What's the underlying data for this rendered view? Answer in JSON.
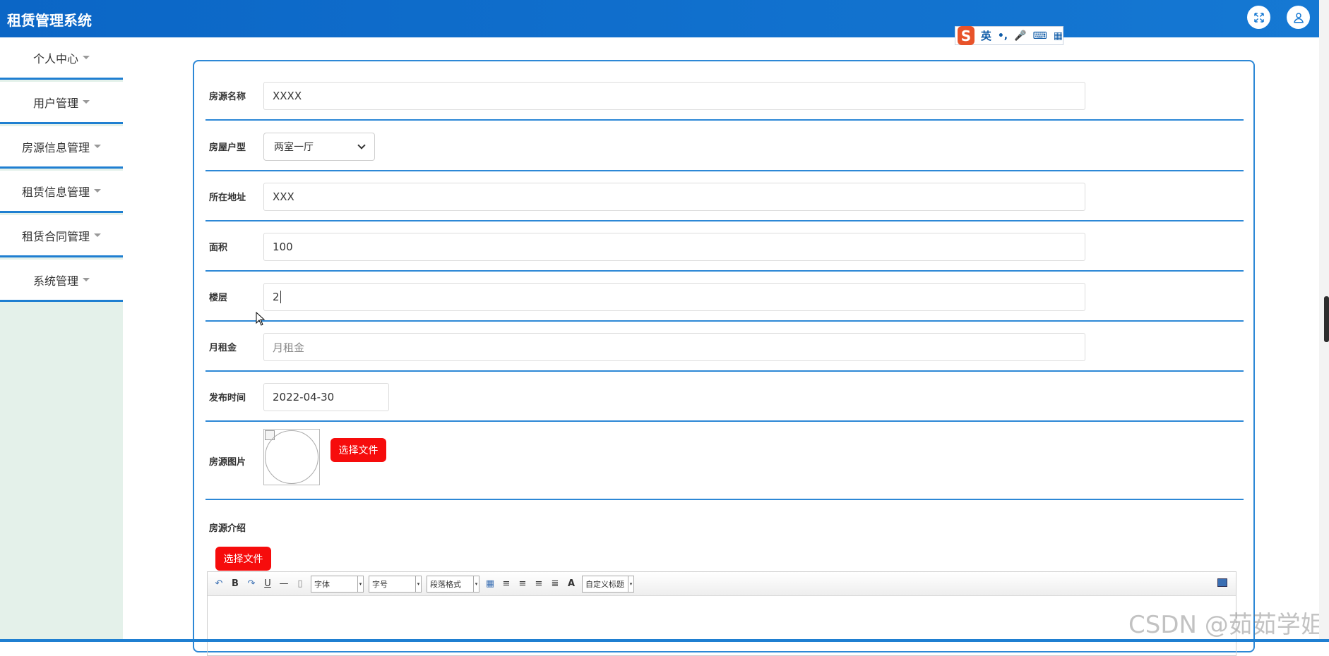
{
  "app": {
    "title": "租赁管理系统"
  },
  "header_icons": [
    {
      "icon": "fullscreen-icon"
    },
    {
      "icon": "user-icon"
    }
  ],
  "ime": {
    "logo": "S",
    "mode": "英",
    "symbols": "•,",
    "mic": "🎤",
    "keyboard": "⌨",
    "apps": "▦"
  },
  "sidebar": {
    "items": [
      {
        "label": "个人中心"
      },
      {
        "label": "用户管理"
      },
      {
        "label": "房源信息管理"
      },
      {
        "label": "租赁信息管理"
      },
      {
        "label": "租赁合同管理"
      },
      {
        "label": "系统管理"
      }
    ]
  },
  "form": {
    "name": {
      "label": "房源名称",
      "value": "XXXX"
    },
    "layout": {
      "label": "房屋户型",
      "value": "两室一厅"
    },
    "address": {
      "label": "所在地址",
      "value": "XXX"
    },
    "area": {
      "label": "面积",
      "value": "100"
    },
    "floor": {
      "label": "楼层",
      "value": "2"
    },
    "rent": {
      "label": "月租金",
      "placeholder": "月租金"
    },
    "publish_time": {
      "label": "发布时间",
      "value": "2022-04-30"
    },
    "image": {
      "label": "房源图片",
      "button": "选择文件"
    },
    "intro": {
      "label": "房源介绍",
      "button": "选择文件"
    }
  },
  "editor": {
    "toolbar": {
      "undo": "↶",
      "bold": "B",
      "redo": "↷",
      "underline": "U",
      "hr": "—",
      "page": "▯",
      "font": "字体",
      "size": "字号",
      "paragraph": "段落格式",
      "font_color": "A",
      "custom_title": "自定义标题"
    }
  },
  "watermark": "CSDN @茹茹学姐"
}
